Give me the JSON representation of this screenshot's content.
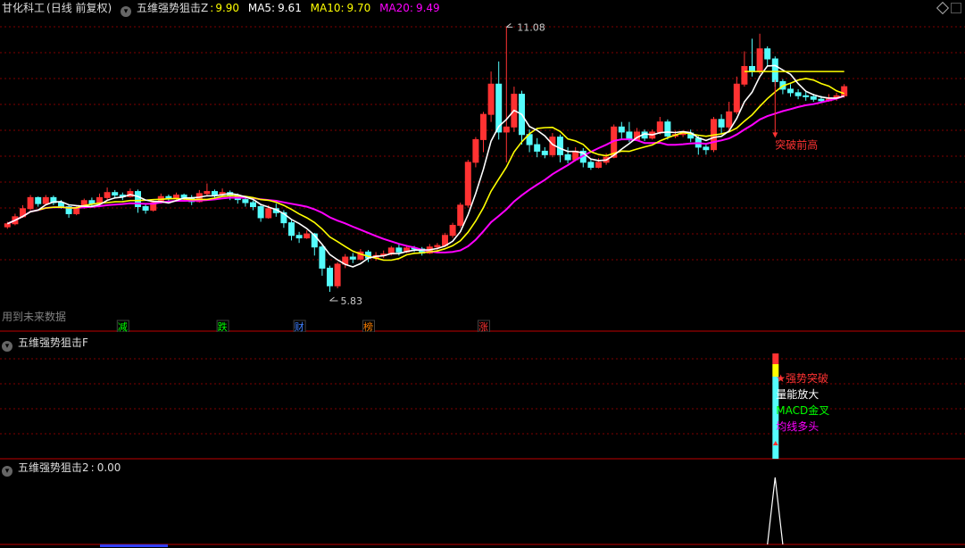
{
  "main": {
    "stock_name": "甘化科工",
    "period": "(日线 前复权)",
    "indicator": "五维强势狙击Z",
    "indicator_value": "9.90",
    "ma5_label": "MA5:",
    "ma5_value": "9.61",
    "ma10_label": "MA10:",
    "ma10_value": "9.70",
    "ma20_label": "MA20:",
    "ma20_value": "9.49",
    "high_label": "11.08",
    "low_label": "5.83",
    "breakout_label": "突破前高",
    "future_data_note": "用到未来数据",
    "event_tags": [
      "减",
      "跌",
      "财",
      "榜",
      "涨"
    ],
    "colors": {
      "up": "#ff3232",
      "down": "#54fcfc",
      "ma5": "#ffffff",
      "ma10": "#ffff00",
      "ma20": "#ff00ff",
      "grid": "#800000",
      "text": "#c0c0c0"
    }
  },
  "panel_f": {
    "title": "五维强势狙击F",
    "signals": [
      "★强势突破",
      "量能放大",
      "MACD金叉",
      "均线多头"
    ],
    "signal_colors": [
      "#ff3232",
      "#ffffff",
      "#00ff00",
      "#ff00ff"
    ]
  },
  "panel_2": {
    "title": "五维强势狙击2",
    "value": "0.00"
  },
  "chart_data": {
    "type": "candlestick",
    "ylim": [
      5.6,
      11.3
    ],
    "candles": [
      [
        7.12,
        7.18,
        7.08,
        7.22
      ],
      [
        7.18,
        7.32,
        7.15,
        7.38
      ],
      [
        7.32,
        7.48,
        7.3,
        7.55
      ],
      [
        7.48,
        7.7,
        7.45,
        7.75
      ],
      [
        7.7,
        7.58,
        7.52,
        7.72
      ],
      [
        7.58,
        7.7,
        7.55,
        7.75
      ],
      [
        7.7,
        7.6,
        7.55,
        7.74
      ],
      [
        7.6,
        7.52,
        7.48,
        7.65
      ],
      [
        7.52,
        7.38,
        7.3,
        7.55
      ],
      [
        7.38,
        7.5,
        7.35,
        7.55
      ],
      [
        7.5,
        7.64,
        7.48,
        7.68
      ],
      [
        7.64,
        7.58,
        7.52,
        7.7
      ],
      [
        7.58,
        7.7,
        7.55,
        7.78
      ],
      [
        7.7,
        7.8,
        7.65,
        7.9
      ],
      [
        7.8,
        7.75,
        7.68,
        7.85
      ],
      [
        7.75,
        7.72,
        7.65,
        7.8
      ],
      [
        7.72,
        7.82,
        7.7,
        7.88
      ],
      [
        7.82,
        7.52,
        7.4,
        7.86
      ],
      [
        7.52,
        7.45,
        7.38,
        7.58
      ],
      [
        7.45,
        7.6,
        7.42,
        7.65
      ],
      [
        7.6,
        7.72,
        7.58,
        7.78
      ],
      [
        7.72,
        7.68,
        7.6,
        7.76
      ],
      [
        7.68,
        7.75,
        7.62,
        7.8
      ],
      [
        7.75,
        7.7,
        7.62,
        7.78
      ],
      [
        7.7,
        7.62,
        7.55,
        7.75
      ],
      [
        7.62,
        7.78,
        7.6,
        7.85
      ],
      [
        7.78,
        7.82,
        7.72,
        7.98
      ],
      [
        7.82,
        7.76,
        7.7,
        7.86
      ],
      [
        7.76,
        7.8,
        7.72,
        7.88
      ],
      [
        7.8,
        7.74,
        7.65,
        7.84
      ],
      [
        7.74,
        7.66,
        7.58,
        7.78
      ],
      [
        7.66,
        7.6,
        7.52,
        7.7
      ],
      [
        7.6,
        7.52,
        7.45,
        7.64
      ],
      [
        7.52,
        7.3,
        7.22,
        7.56
      ],
      [
        7.3,
        7.48,
        7.28,
        7.55
      ],
      [
        7.48,
        7.4,
        7.32,
        7.58
      ],
      [
        7.4,
        7.2,
        7.1,
        7.45
      ],
      [
        7.2,
        6.95,
        6.85,
        7.25
      ],
      [
        6.95,
        6.9,
        6.8,
        7.02
      ],
      [
        6.9,
        6.98,
        6.88,
        7.05
      ],
      [
        6.98,
        6.72,
        6.55,
        7.0
      ],
      [
        6.72,
        6.3,
        6.15,
        6.75
      ],
      [
        6.3,
        5.95,
        5.83,
        6.35
      ],
      [
        5.95,
        6.38,
        5.9,
        6.42
      ],
      [
        6.38,
        6.52,
        6.3,
        6.58
      ],
      [
        6.52,
        6.48,
        6.4,
        6.6
      ],
      [
        6.48,
        6.62,
        6.45,
        6.68
      ],
      [
        6.62,
        6.5,
        6.42,
        6.66
      ],
      [
        6.5,
        6.55,
        6.45,
        6.62
      ],
      [
        6.55,
        6.58,
        6.5,
        6.65
      ],
      [
        6.58,
        6.7,
        6.55,
        6.74
      ],
      [
        6.7,
        6.62,
        6.55,
        6.78
      ],
      [
        6.62,
        6.7,
        6.6,
        6.76
      ],
      [
        6.7,
        6.68,
        6.62,
        6.74
      ],
      [
        6.68,
        6.6,
        6.55,
        6.72
      ],
      [
        6.6,
        6.72,
        6.58,
        6.78
      ],
      [
        6.72,
        6.75,
        6.65,
        6.8
      ],
      [
        6.75,
        6.95,
        6.72,
        7.0
      ],
      [
        6.95,
        7.15,
        6.9,
        7.2
      ],
      [
        7.15,
        7.55,
        7.1,
        7.6
      ],
      [
        7.55,
        8.4,
        7.5,
        8.45
      ],
      [
        8.4,
        8.85,
        8.3,
        8.9
      ],
      [
        8.85,
        9.35,
        8.6,
        9.4
      ],
      [
        9.35,
        9.95,
        9.2,
        10.2
      ],
      [
        9.95,
        9.0,
        8.85,
        10.4
      ],
      [
        9.0,
        9.1,
        8.4,
        11.08
      ],
      [
        9.1,
        9.75,
        9.0,
        9.9
      ],
      [
        9.75,
        8.95,
        8.75,
        9.82
      ],
      [
        8.95,
        8.75,
        8.6,
        9.05
      ],
      [
        8.75,
        8.62,
        8.5,
        8.88
      ],
      [
        8.62,
        8.55,
        8.48,
        8.7
      ],
      [
        8.55,
        8.9,
        8.5,
        8.98
      ],
      [
        8.9,
        8.55,
        8.4,
        8.95
      ],
      [
        8.55,
        8.45,
        8.38,
        8.7
      ],
      [
        8.45,
        8.62,
        8.42,
        8.7
      ],
      [
        8.62,
        8.4,
        8.3,
        8.68
      ],
      [
        8.4,
        8.3,
        8.25,
        8.46
      ],
      [
        8.3,
        8.4,
        8.28,
        8.48
      ],
      [
        8.4,
        8.5,
        8.35,
        8.58
      ],
      [
        8.5,
        9.1,
        8.48,
        9.15
      ],
      [
        9.1,
        9.0,
        8.85,
        9.2
      ],
      [
        9.0,
        8.85,
        8.8,
        9.2
      ],
      [
        8.85,
        9.0,
        8.82,
        9.08
      ],
      [
        9.0,
        8.88,
        8.82,
        9.05
      ],
      [
        8.88,
        9.0,
        8.85,
        9.05
      ],
      [
        9.0,
        9.2,
        8.95,
        9.3
      ],
      [
        9.2,
        8.92,
        8.85,
        9.25
      ],
      [
        8.92,
        8.95,
        8.88,
        9.02
      ],
      [
        8.95,
        8.98,
        8.9,
        9.02
      ],
      [
        8.98,
        8.88,
        8.8,
        9.05
      ],
      [
        8.88,
        8.7,
        8.55,
        8.92
      ],
      [
        8.7,
        8.65,
        8.55,
        8.75
      ],
      [
        8.65,
        9.25,
        8.6,
        9.3
      ],
      [
        9.25,
        9.1,
        8.95,
        9.35
      ],
      [
        9.1,
        9.4,
        9.05,
        9.6
      ],
      [
        9.4,
        9.95,
        9.35,
        10.1
      ],
      [
        9.95,
        10.3,
        9.9,
        10.6
      ],
      [
        10.3,
        10.2,
        10.1,
        10.85
      ],
      [
        10.2,
        10.65,
        10.15,
        10.95
      ],
      [
        10.65,
        10.45,
        10.3,
        10.7
      ],
      [
        10.45,
        10.0,
        9.9,
        10.5
      ],
      [
        10.0,
        9.85,
        9.75,
        10.05
      ],
      [
        9.85,
        9.78,
        9.7,
        9.95
      ],
      [
        9.78,
        9.72,
        9.65,
        9.85
      ],
      [
        9.72,
        9.7,
        9.62,
        9.8
      ],
      [
        9.7,
        9.65,
        9.6,
        9.76
      ],
      [
        9.65,
        9.62,
        9.58,
        9.72
      ],
      [
        9.62,
        9.68,
        9.6,
        9.75
      ],
      [
        9.68,
        9.72,
        9.62,
        9.78
      ],
      [
        9.72,
        9.9,
        9.68,
        9.95
      ]
    ],
    "hline_value": 10.2,
    "event_tag_indices": [
      15,
      28,
      38,
      47,
      62
    ],
    "signal_panel_F_index": 100,
    "signal_2_index": 100,
    "signal_2_peak": 1
  }
}
